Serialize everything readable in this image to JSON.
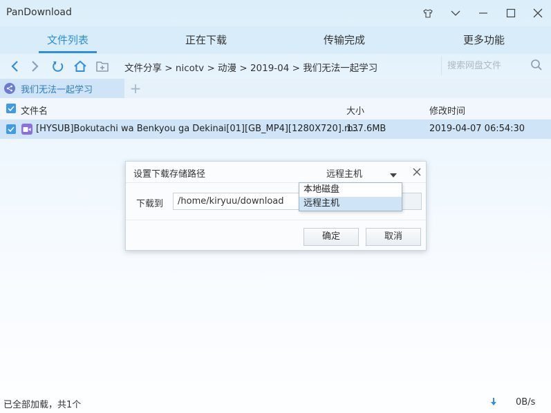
{
  "app": {
    "title": "PanDownload"
  },
  "tabs": [
    {
      "label": "文件列表",
      "active": true
    },
    {
      "label": "正在下载",
      "active": false
    },
    {
      "label": "传输完成",
      "active": false
    },
    {
      "label": "更多功能",
      "active": false
    }
  ],
  "nav": {
    "breadcrumb": "文件分享 > nicotv > 动漫 > 2019-04 > 我们无法一起学习",
    "search_placeholder": "搜索网盘文件"
  },
  "folder_tab": {
    "label": "我们无法一起学习"
  },
  "table": {
    "headers": {
      "name": "文件名",
      "size": "大小",
      "modified": "修改时间"
    },
    "rows": [
      {
        "name": "[HYSUB]Bokutachi wa Benkyou ga Dekinai[01][GB_MP4][1280X720].m...",
        "size": "137.6MB",
        "modified": "2019-04-07 06:54:30"
      }
    ]
  },
  "dialog": {
    "title": "设置下载存储路径",
    "mode_selected": "远程主机",
    "download_to_label": "下载到",
    "path_value": "/home/kiryuu/download",
    "ok_label": "确定",
    "cancel_label": "取消",
    "dropdown_options": [
      "本地磁盘",
      "远程主机"
    ]
  },
  "status": {
    "text": "已全部加载，共1个",
    "speed": "0B/s"
  },
  "colors": {
    "accent": "#2c8fe0",
    "selected_row": "#cfe5f7"
  }
}
